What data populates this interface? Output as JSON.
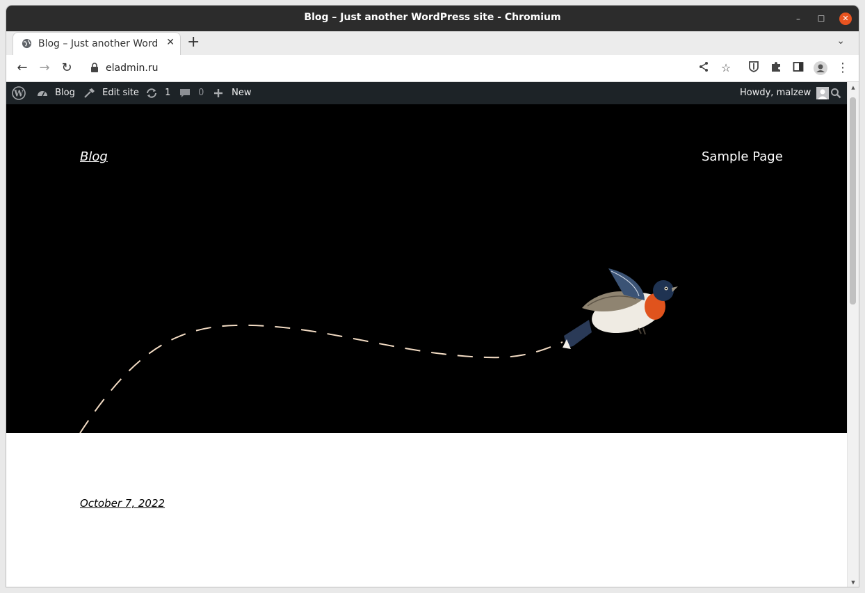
{
  "window": {
    "title": "Blog – Just another WordPress site - Chromium",
    "minimize_icon": "minimize-icon",
    "maximize_icon": "maximize-icon",
    "close_icon": "close-icon"
  },
  "tab": {
    "title": "Blog – Just another WordPress site",
    "favicon": "globe-icon"
  },
  "toolbar": {
    "url": "eladmin.ru"
  },
  "adminbar": {
    "blog_label": "Blog",
    "edit_site_label": "Edit site",
    "updates_count": "1",
    "comments_count": "0",
    "new_label": "New",
    "howdy_label": "Howdy, malzew"
  },
  "site": {
    "title": "Blog",
    "nav": [
      "Sample Page"
    ],
    "post_date": "October 7, 2022"
  },
  "colors": {
    "titlebar": "#2c2c2c",
    "adminbar": "#1d2327",
    "hero": "#000000",
    "close_button": "#e95420",
    "flight_path": "#f3dcc4"
  }
}
